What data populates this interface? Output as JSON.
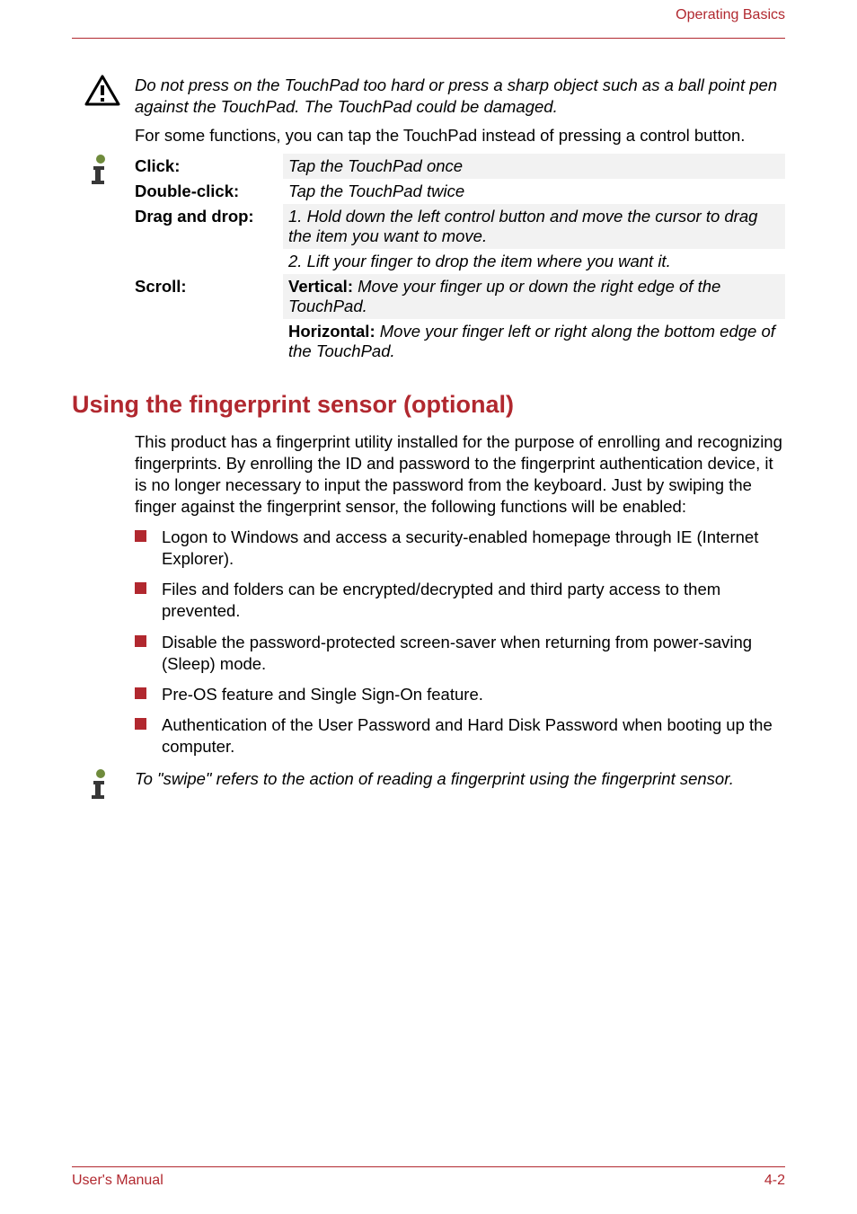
{
  "header": {
    "section": "Operating Basics"
  },
  "warning": {
    "text": "Do not press on the TouchPad too hard or press a sharp object such as a ball point pen against the TouchPad. The TouchPad could be damaged."
  },
  "after_warning": "For some functions, you can tap the TouchPad instead of pressing a control button.",
  "gestures": {
    "click_label": "Click:",
    "click_desc": "Tap the TouchPad once",
    "dblclick_label": "Double-click:",
    "dblclick_desc": "Tap the TouchPad twice",
    "drag_label": "Drag and drop:",
    "drag_desc1": "1.   Hold down the left control button and move the cursor to drag the item you want to move.",
    "drag_desc2": "2.  Lift your finger to drop the item where you want it.",
    "scroll_label": "Scroll:",
    "scroll_vert_label": "Vertical:",
    "scroll_vert_desc": " Move your finger up or down the right edge of the TouchPad.",
    "scroll_horiz_label": "Horizontal:",
    "scroll_horiz_desc": " Move your finger left or right along the bottom edge of the TouchPad."
  },
  "section_heading": "Using the fingerprint sensor (optional)",
  "intro": "This product has a fingerprint utility installed for the purpose of enrolling and recognizing fingerprints. By enrolling the ID and password to the fingerprint authentication device, it is no longer necessary to input the password from the keyboard. Just by swiping the finger against the fingerprint sensor, the following functions will be enabled:",
  "bullets": [
    "Logon to Windows and access a security-enabled homepage through IE (Internet Explorer).",
    "Files and folders can be encrypted/decrypted and third party access to them prevented.",
    "Disable the password-protected screen-saver when returning from power-saving (Sleep) mode.",
    "Pre-OS feature and Single Sign-On feature.",
    "Authentication of the User Password and Hard Disk Password when booting up the computer."
  ],
  "swipe_note": "To \"swipe\" refers to the action of reading a fingerprint using the fingerprint sensor.",
  "footer": {
    "left": "User's Manual",
    "right": "4-2"
  }
}
